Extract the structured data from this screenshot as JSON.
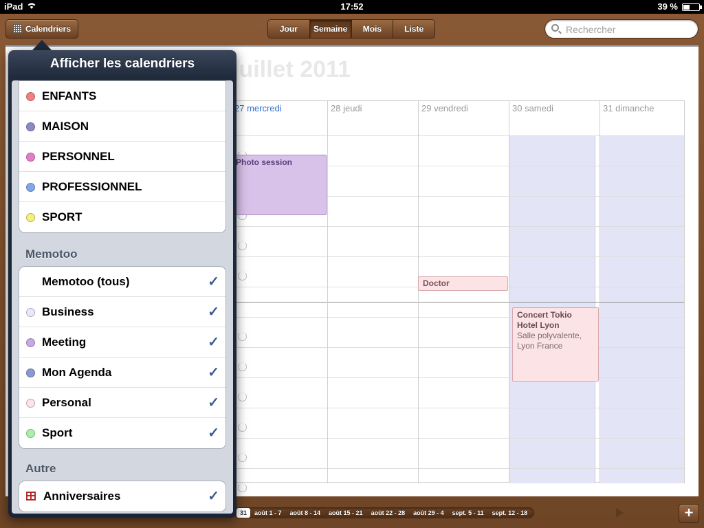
{
  "status_bar": {
    "device": "iPad",
    "time": "17:52",
    "battery": "39 %",
    "battery_level": 0.39
  },
  "toolbar": {
    "calendars_button": "Calendriers",
    "views": [
      {
        "label": "Jour",
        "active": false
      },
      {
        "label": "Semaine",
        "active": true
      },
      {
        "label": "Mois",
        "active": false
      },
      {
        "label": "Liste",
        "active": false
      }
    ],
    "search_placeholder": "Rechercher"
  },
  "week": {
    "month_title": "juillet 2011",
    "days": [
      {
        "label": "27 mercredi",
        "today": true
      },
      {
        "label": "28 jeudi",
        "today": false
      },
      {
        "label": "29 vendredi",
        "today": false
      },
      {
        "label": "30 samedi",
        "today": false
      },
      {
        "label": "31 dimanche",
        "today": false
      }
    ],
    "events": [
      {
        "title": "Photo session",
        "color": "#d8c2ea"
      },
      {
        "title": "Doctor",
        "color": "#fbe3e6"
      },
      {
        "title": "Concert Tokio Hotel Lyon",
        "location": "Salle polyvalente, Lyon France",
        "color": "#fbe3e6"
      }
    ]
  },
  "timeline": {
    "current": "31",
    "items": [
      "août 1 - 7",
      "août 8 - 14",
      "août 15 - 21",
      "août 22 - 28",
      "août 29 - 4",
      "sept. 5 - 11",
      "sept. 12 - 18"
    ]
  },
  "popover": {
    "title": "Afficher les calendriers",
    "local_calendars": [
      {
        "label": "ENFANTS",
        "color": "#f08080"
      },
      {
        "label": "MAISON",
        "color": "#8a8ac8"
      },
      {
        "label": "PERSONNEL",
        "color": "#e07fc8"
      },
      {
        "label": "PROFESSIONNEL",
        "color": "#80a8e8"
      },
      {
        "label": "SPORT",
        "color": "#f5f07a"
      }
    ],
    "memotoo_header": "Memotoo",
    "memotoo_calendars": [
      {
        "label": "Memotoo (tous)",
        "color": null,
        "checked": true
      },
      {
        "label": "Business",
        "color": "#e8e8f8",
        "checked": true
      },
      {
        "label": "Meeting",
        "color": "#c8a8e0",
        "checked": true
      },
      {
        "label": "Mon Agenda",
        "color": "#8a9ad0",
        "checked": true
      },
      {
        "label": "Personal",
        "color": "#fbe3e6",
        "checked": true
      },
      {
        "label": "Sport",
        "color": "#a8f0a8",
        "checked": true
      }
    ],
    "other_header": "Autre",
    "other_calendars": [
      {
        "label": "Anniversaires",
        "icon": "gift-icon",
        "checked": true
      }
    ],
    "check_glyph": "✓"
  }
}
